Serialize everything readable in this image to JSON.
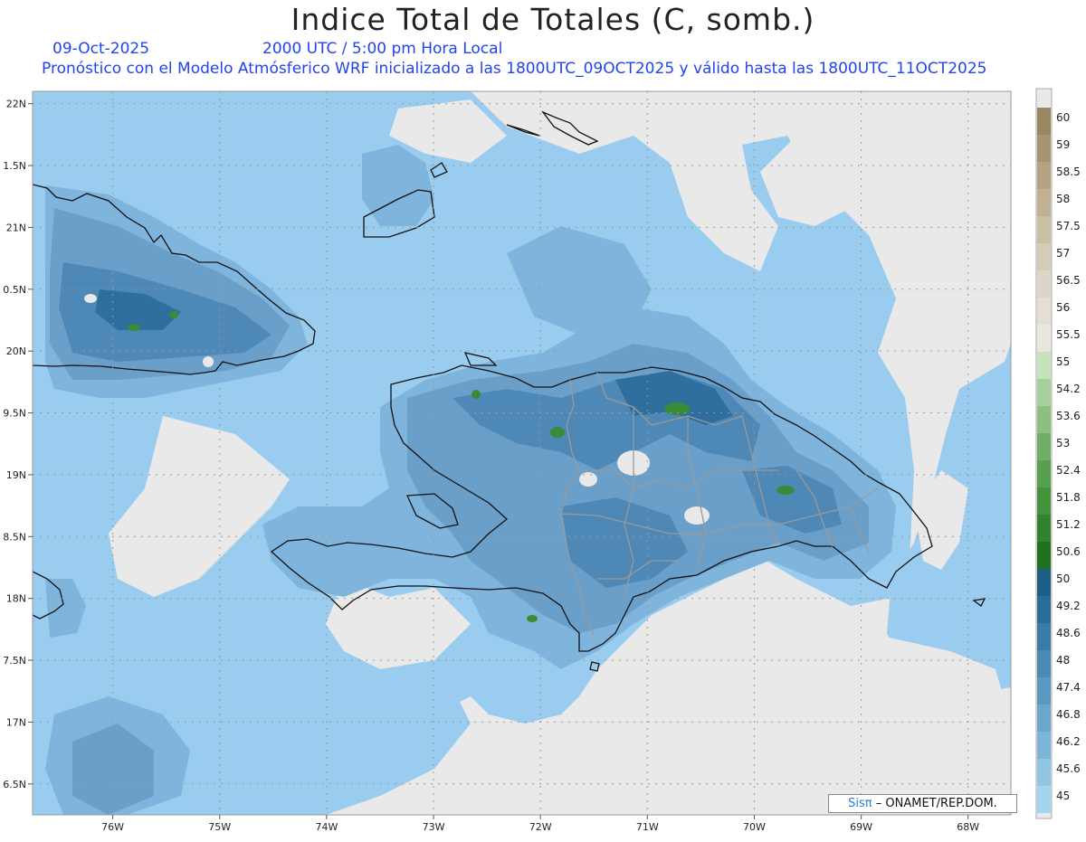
{
  "title": "Indice Total de Totales (C, somb.)",
  "date_label": "09-Oct-2025",
  "time_label": "2000 UTC / 5:00 pm Hora Local",
  "description": "Pronóstico con el Modelo Atmósferico WRF inicializado a las 1800UTC_09OCT2025 y válido hasta las  1800UTC_11OCT2025",
  "credit": {
    "logo": "Sisπ",
    "text": "– ONAMET/REP.DOM."
  },
  "map": {
    "lon_range": [
      -76.75,
      -67.6
    ],
    "lat_range": [
      16.25,
      22.1
    ],
    "lon_ticks": [
      {
        "value": -76,
        "label": "76W"
      },
      {
        "value": -75,
        "label": "75W"
      },
      {
        "value": -74,
        "label": "74W"
      },
      {
        "value": -73,
        "label": "73W"
      },
      {
        "value": -72,
        "label": "72W"
      },
      {
        "value": -71,
        "label": "71W"
      },
      {
        "value": -70,
        "label": "70W"
      },
      {
        "value": -69,
        "label": "69W"
      },
      {
        "value": -68,
        "label": "68W"
      }
    ],
    "lat_ticks": [
      {
        "value": 22,
        "label": "22N"
      },
      {
        "value": 21.5,
        "label": "1.5N"
      },
      {
        "value": 21,
        "label": "21N"
      },
      {
        "value": 20.5,
        "label": "0.5N"
      },
      {
        "value": 20,
        "label": "20N"
      },
      {
        "value": 19.5,
        "label": "9.5N"
      },
      {
        "value": 19,
        "label": "19N"
      },
      {
        "value": 18.5,
        "label": "8.5N"
      },
      {
        "value": 18,
        "label": "18N"
      },
      {
        "value": 17.5,
        "label": "7.5N"
      },
      {
        "value": 17,
        "label": "17N"
      },
      {
        "value": 16.5,
        "label": "6.5N"
      }
    ],
    "grid": true,
    "colors": {
      "background": "#e9e9e9",
      "coast": "#111111",
      "provinces": "#9a9a9a",
      "shade_45": "#99ccee",
      "shade_46": "#7fb4dc",
      "shade_47": "#6a9fca",
      "shade_48": "#4e88b6",
      "shade_49": "#2f6f9d",
      "shade_50": "#3a8a3a"
    }
  },
  "colorbar": {
    "levels": [
      "60",
      "59",
      "58.5",
      "58",
      "57.5",
      "57",
      "56.5",
      "56",
      "55.5",
      "55",
      "54.2",
      "53.6",
      "53",
      "52.4",
      "51.8",
      "51.2",
      "50.6",
      "50",
      "49.2",
      "48.6",
      "48",
      "47.4",
      "46.8",
      "46.2",
      "45.6",
      "45"
    ],
    "colors": [
      "#9a8660",
      "#a89472",
      "#b4a382",
      "#c0b193",
      "#cabfa4",
      "#d4ccb8",
      "#ddd6c8",
      "#e4dfd4",
      "#eae7de",
      "#c7e3bd",
      "#a8d09c",
      "#8cbf80",
      "#70ad66",
      "#58a050",
      "#45923d",
      "#33822d",
      "#217020",
      "#1d5f85",
      "#296d96",
      "#3a7ca6",
      "#4b8ab3",
      "#5b98c0",
      "#6ca6cc",
      "#7db5d8",
      "#91c5e4",
      "#a5d4ef"
    ]
  }
}
